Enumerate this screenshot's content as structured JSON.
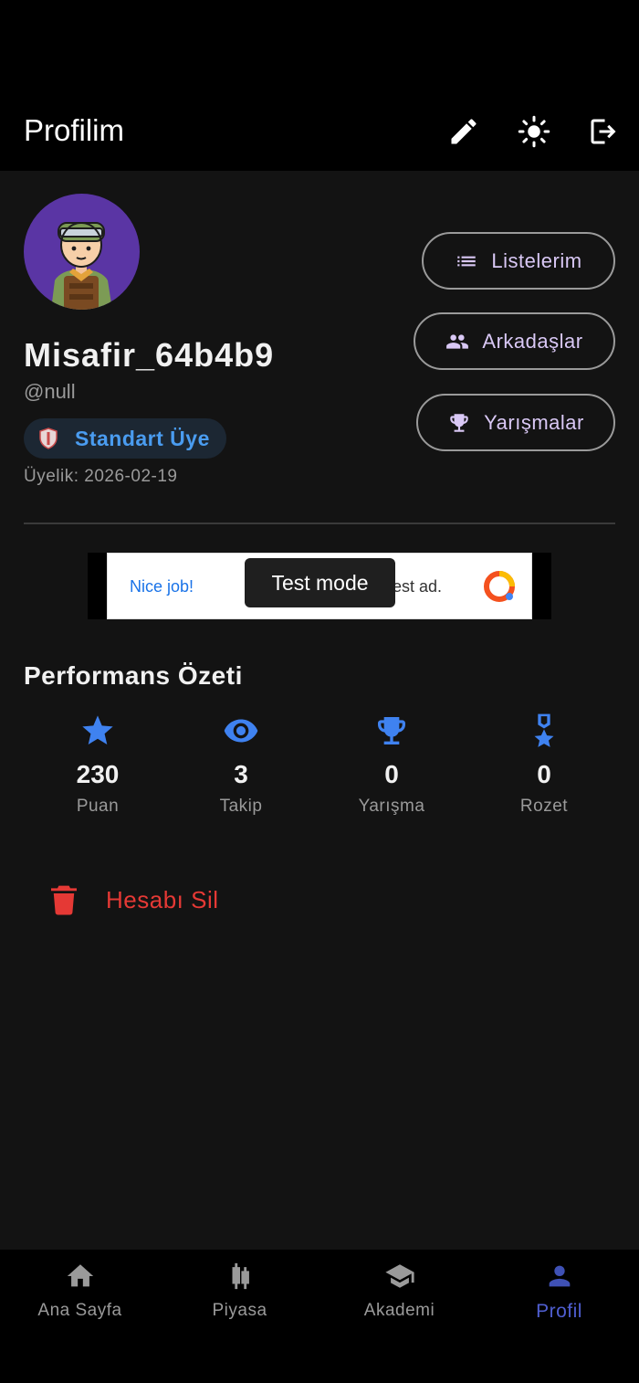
{
  "app_bar": {
    "title": "Profilim",
    "icons": [
      "edit-icon",
      "brightness-icon",
      "logout-icon"
    ]
  },
  "profile": {
    "username": "Misafir_64b4b9",
    "handle": "@null",
    "membership_label": "Standart Üye",
    "member_since": "Üyelik: 2026-02-19",
    "avatar_icon": "soldier-avatar"
  },
  "actions": {
    "lists": "Listelerim",
    "friends": "Arkadaşlar",
    "competitions": "Yarışmalar"
  },
  "ad": {
    "left_text": "Nice job!",
    "right_text": "est ad.",
    "toast": "Test mode"
  },
  "performance": {
    "title": "Performans Özeti",
    "stats": [
      {
        "value": "230",
        "label": "Puan",
        "icon": "star-icon"
      },
      {
        "value": "3",
        "label": "Takip",
        "icon": "eye-icon"
      },
      {
        "value": "0",
        "label": "Yarışma",
        "icon": "trophy-icon"
      },
      {
        "value": "0",
        "label": "Rozet",
        "icon": "medal-icon"
      }
    ]
  },
  "danger": {
    "delete_label": "Hesabı Sil"
  },
  "bottom_nav": {
    "items": [
      {
        "label": "Ana Sayfa",
        "icon": "home-icon"
      },
      {
        "label": "Piyasa",
        "icon": "candlestick-icon"
      },
      {
        "label": "Akademi",
        "icon": "school-icon"
      },
      {
        "label": "Profil",
        "icon": "person-icon"
      }
    ],
    "active": "Profil"
  },
  "colors": {
    "accent_blue": "#3f82f0",
    "pill_text": "#d9c8f5",
    "danger": "#e53935",
    "nav_active": "#3f51b5"
  }
}
